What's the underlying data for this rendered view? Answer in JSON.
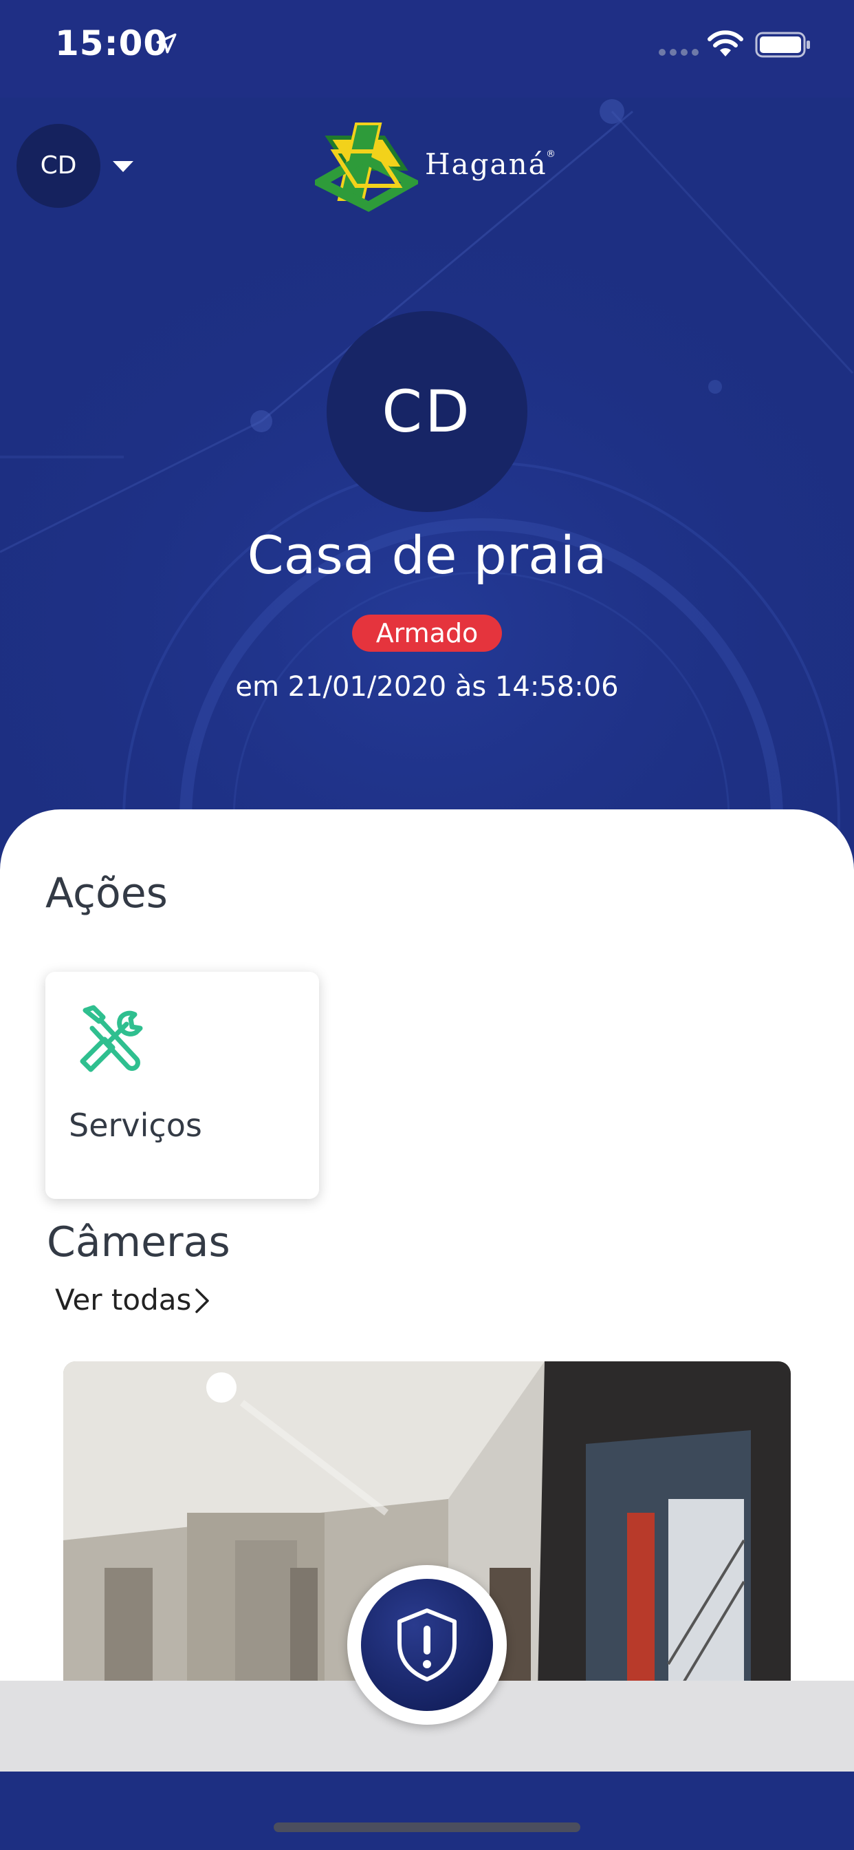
{
  "status_bar": {
    "time": "15:00"
  },
  "header": {
    "account_initials": "CD",
    "logo_text": "Haganá",
    "logo_reg": "®"
  },
  "site": {
    "initials": "CD",
    "name": "Casa de praia",
    "status": "Armado",
    "status_time": "em 21/01/2020 às 14:58:06"
  },
  "actions": {
    "title": "Ações",
    "items": [
      {
        "label": "Serviços",
        "icon": "tools-icon"
      }
    ]
  },
  "cameras": {
    "title": "Câmeras",
    "see_all": "Ver todas"
  },
  "colors": {
    "primary": "#1d2f82",
    "badge": "#e5343d",
    "accent_icon": "#2fbf8f"
  }
}
